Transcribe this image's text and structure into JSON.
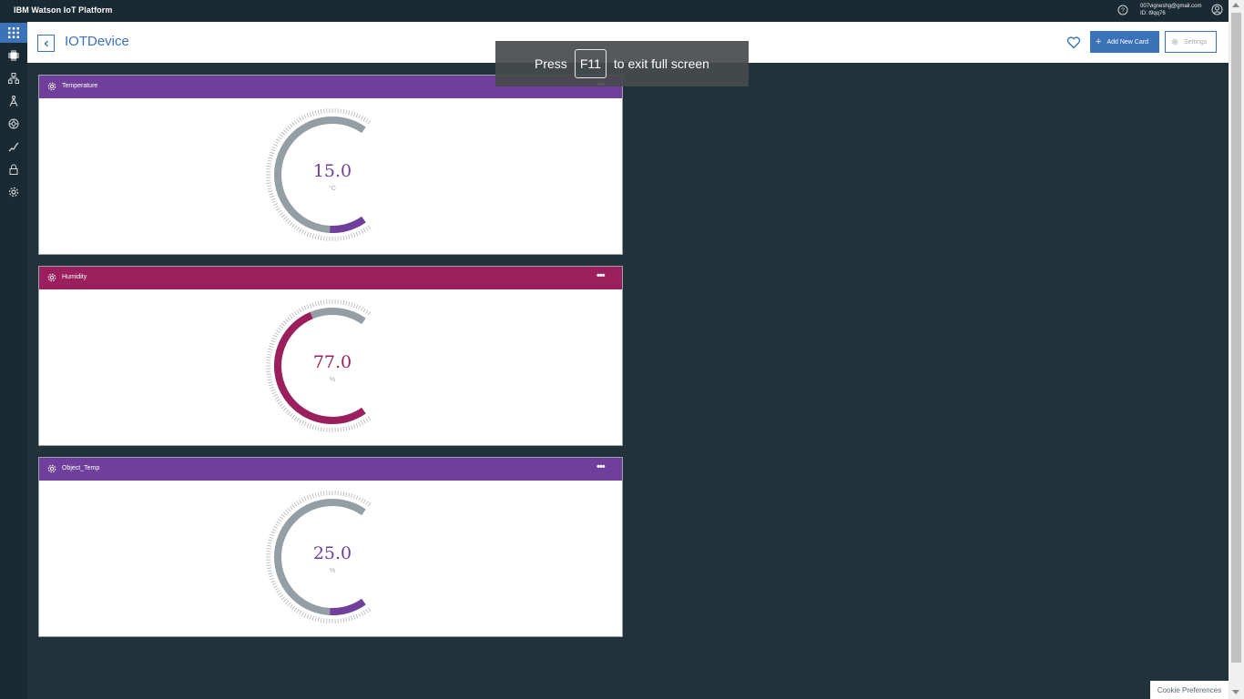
{
  "topbar": {
    "brand": "IBM Watson IoT Platform",
    "user_email": "007vigneshg@gmail.com",
    "org_id": "ID: t9qq76"
  },
  "sidebar": {
    "items": [
      {
        "icon": "apps-grid-icon",
        "active": true
      },
      {
        "icon": "devices-chip-icon",
        "active": false
      },
      {
        "icon": "members-icon",
        "active": false
      },
      {
        "icon": "apps-icon",
        "active": false
      },
      {
        "icon": "extensions-icon",
        "active": false
      },
      {
        "icon": "rules-icon",
        "active": false
      },
      {
        "icon": "security-lock-icon",
        "active": false
      },
      {
        "icon": "settings-gear-icon",
        "active": false
      }
    ]
  },
  "header": {
    "title": "IOTDevice",
    "add_card_label": "Add New Card",
    "settings_label": "Settings"
  },
  "toast": {
    "prefix": "Press",
    "key": "F11",
    "suffix": "to exit full screen"
  },
  "cards": [
    {
      "title": "Temperature",
      "value": "15.0",
      "unit": "°C",
      "color": "#6f3f9b",
      "fraction": 0.15
    },
    {
      "title": "Humidity",
      "value": "77.0",
      "unit": "%",
      "color": "#9c1f5d",
      "fraction": 0.77
    },
    {
      "title": "Object_Temp",
      "value": "25.0",
      "unit": "%",
      "color": "#6f3f9b",
      "fraction": 0.15
    }
  ],
  "footer": {
    "cookie_label": "Cookie Preferences"
  }
}
